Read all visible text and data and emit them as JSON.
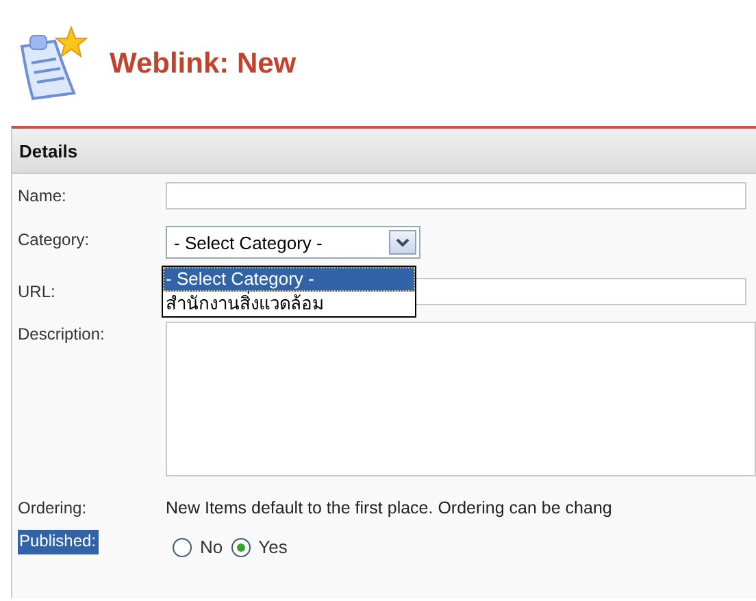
{
  "page": {
    "title": "Weblink: New"
  },
  "panel": {
    "title": "Details"
  },
  "fields": [
    {
      "kind": "text",
      "label": "Name:"
    },
    {
      "kind": "select",
      "label": "Category:",
      "value": "- Select Category -",
      "open": true,
      "options": [
        {
          "label": "- Select Category -",
          "selected": true
        },
        {
          "label": "สำนักงานสิ่งแวดล้อม",
          "selected": false
        }
      ]
    },
    {
      "kind": "text",
      "label": "URL:"
    },
    {
      "kind": "textarea",
      "label": "Description:"
    },
    {
      "kind": "note",
      "label": "Ordering:",
      "text": "New Items default to the first place. Ordering can be chang"
    },
    {
      "kind": "radio",
      "label": "Published:",
      "highlighted": true,
      "options": [
        {
          "label": "No",
          "selected": false
        },
        {
          "label": "Yes",
          "selected": true
        }
      ]
    }
  ]
}
